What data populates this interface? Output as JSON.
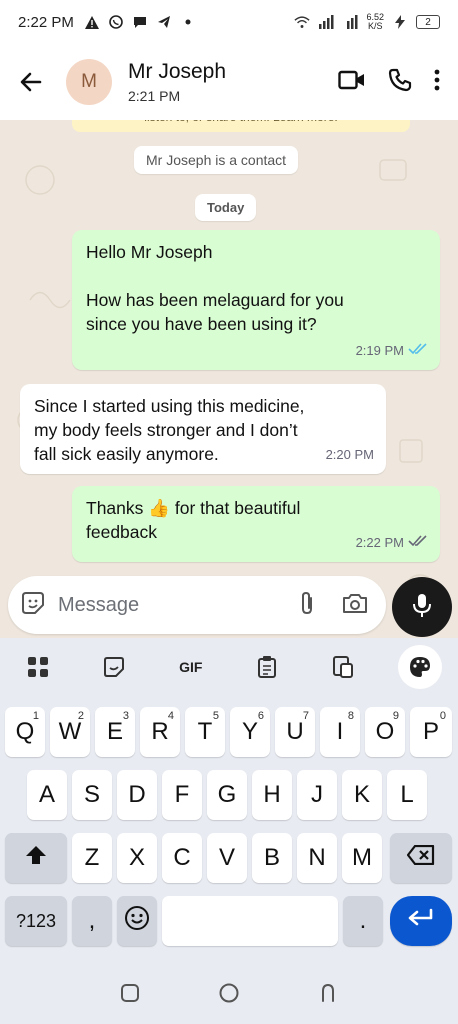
{
  "status_bar": {
    "time": "2:22 PM",
    "net_speed_top": "6.52",
    "net_speed_bottom": "K/S",
    "battery": "2"
  },
  "header": {
    "avatar_letter": "M",
    "contact_name": "Mr Joseph",
    "last_seen": "2:21 PM"
  },
  "chat": {
    "encryption_banner_fragment": "listen to, or share them. Learn more.",
    "contact_chip": "Mr Joseph is a contact",
    "date_chip": "Today",
    "messages": [
      {
        "direction": "out",
        "lines": [
          "Hello Mr Joseph",
          "",
          "How has been melaguard for you",
          "since you have been using it?"
        ],
        "time": "2:19 PM",
        "status": "read"
      },
      {
        "direction": "in",
        "lines": [
          "Since I started using this medicine,",
          "my body feels stronger and I don’t",
          "fall sick easily anymore."
        ],
        "time": "2:20 PM"
      },
      {
        "direction": "out",
        "lines": [
          "Thanks 👍 for that beautiful",
          "feedback"
        ],
        "time": "2:22 PM",
        "status": "delivered"
      }
    ]
  },
  "composer": {
    "placeholder": "Message"
  },
  "keyboard": {
    "toolbar": [
      "apps-icon",
      "sticker-icon",
      "GIF",
      "clipboard-icon",
      "translate-icon",
      "palette-icon"
    ],
    "gif_label": "GIF",
    "row1": [
      "Q",
      "W",
      "E",
      "R",
      "T",
      "Y",
      "U",
      "I",
      "O",
      "P"
    ],
    "row1_hints": [
      "1",
      "2",
      "3",
      "4",
      "5",
      "6",
      "7",
      "8",
      "9",
      "0"
    ],
    "row2": [
      "A",
      "S",
      "D",
      "F",
      "G",
      "H",
      "J",
      "K",
      "L"
    ],
    "row3": [
      "Z",
      "X",
      "C",
      "V",
      "B",
      "N",
      "M"
    ],
    "symbols_key": "?123",
    "comma_key": ",",
    "period_key": ".",
    "colors": {
      "enter": "#0b57d0",
      "outgoing_bubble": "#d9fdd3"
    }
  }
}
